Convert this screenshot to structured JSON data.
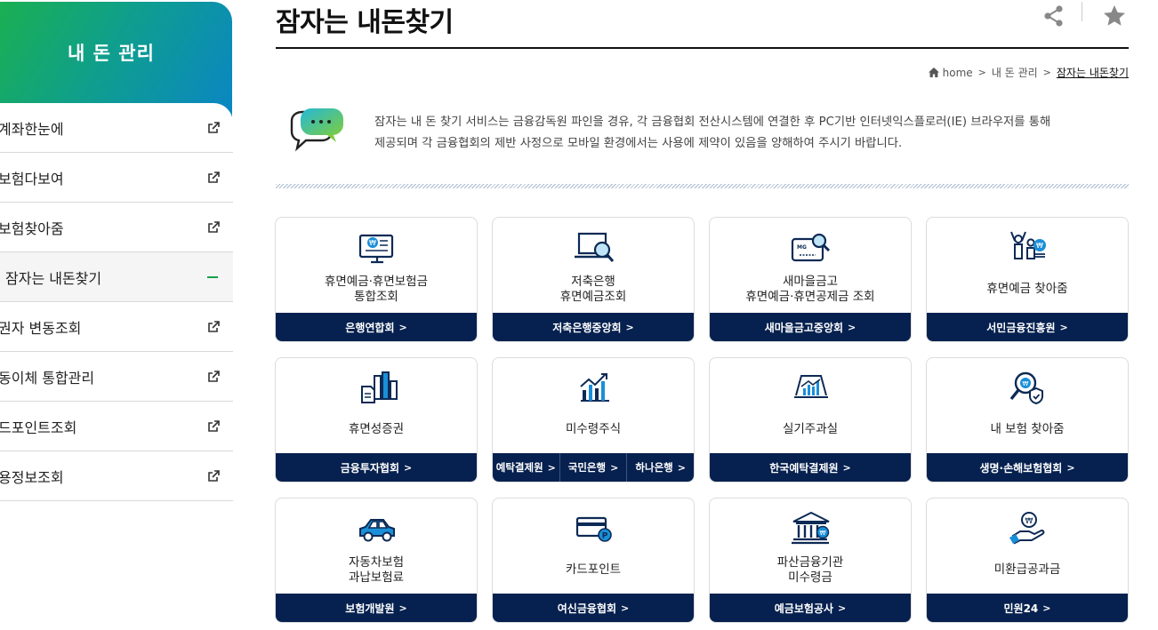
{
  "sidebar": {
    "title": "내 돈 관리",
    "items": [
      {
        "label": "계좌한눈에",
        "type": "external"
      },
      {
        "label": "보험다보여",
        "type": "external"
      },
      {
        "label": "보험찾아줌",
        "type": "external"
      },
      {
        "label": "잠자는 내돈찾기",
        "type": "active"
      },
      {
        "label": "권자 변동조회",
        "type": "external"
      },
      {
        "label": "동이체 통합관리",
        "type": "external"
      },
      {
        "label": "드포인트조회",
        "type": "external"
      },
      {
        "label": "용정보조회",
        "type": "external"
      }
    ]
  },
  "header": {
    "title": "잠자는 내돈찾기"
  },
  "breadcrumb": {
    "home": "home",
    "parent": "내 돈 관리",
    "current": "잠자는 내돈찾기"
  },
  "notice": {
    "line1": "잠자는 내 돈 찾기 서비스는 금융감독원 파인을 경유, 각 금융협회 전산시스템에 연결한 후 PC기반 인터넷익스플로러(IE) 브라우저를 통해",
    "line2": "제공되며 각 금융협회의 제반 사정으로 모바일 환경에서는 사용에 제약이 있음을 양해하여 주시기 바랍니다."
  },
  "cards": [
    {
      "text": "휴면예금·휴면보험금\n통합조회",
      "icon": "monitor-won-icon",
      "link": "은행연합회"
    },
    {
      "text": "저축은행\n휴면예금조회",
      "icon": "laptop-search-icon",
      "link": "저축은행중앙회"
    },
    {
      "text": "새마을금고\n휴면예금·휴면공제금 조회",
      "icon": "mg-card-search-icon",
      "link": "새마을금고중앙회"
    },
    {
      "text": "휴면예금 찾아줌",
      "icon": "people-cheer-coin-icon",
      "link": "서민금융진흥원"
    },
    {
      "text": "휴면성증권",
      "icon": "bar-chart-document-icon",
      "link": "금융투자협회"
    },
    {
      "text": "미수령주식",
      "icon": "stock-growth-icon",
      "links": [
        "예탁결제원",
        "국민은행",
        "하나은행"
      ]
    },
    {
      "text": "실기주과실",
      "icon": "easel-chart-icon",
      "link": "한국예탁결제원"
    },
    {
      "text": "내 보험 찾아줌",
      "icon": "search-won-shield-icon",
      "link": "생명·손해보험협회"
    },
    {
      "text": "자동차보험\n과납보험료",
      "icon": "car-icon",
      "link": "보험개발원"
    },
    {
      "text": "카드포인트",
      "icon": "card-point-icon",
      "link": "여신금융협회"
    },
    {
      "text": "파산금융기관\n미수령금",
      "icon": "bank-building-icon",
      "link": "예금보험공사"
    },
    {
      "text": "미환급공과금",
      "icon": "hand-coin-icon",
      "link": "민원24"
    }
  ],
  "colors": {
    "footer_bg": "#06214f",
    "accent_green": "#1bb24a",
    "accent_blue": "#0a86c4",
    "icon_blue": "#1a8fd8",
    "icon_navy": "#0d2a55"
  }
}
